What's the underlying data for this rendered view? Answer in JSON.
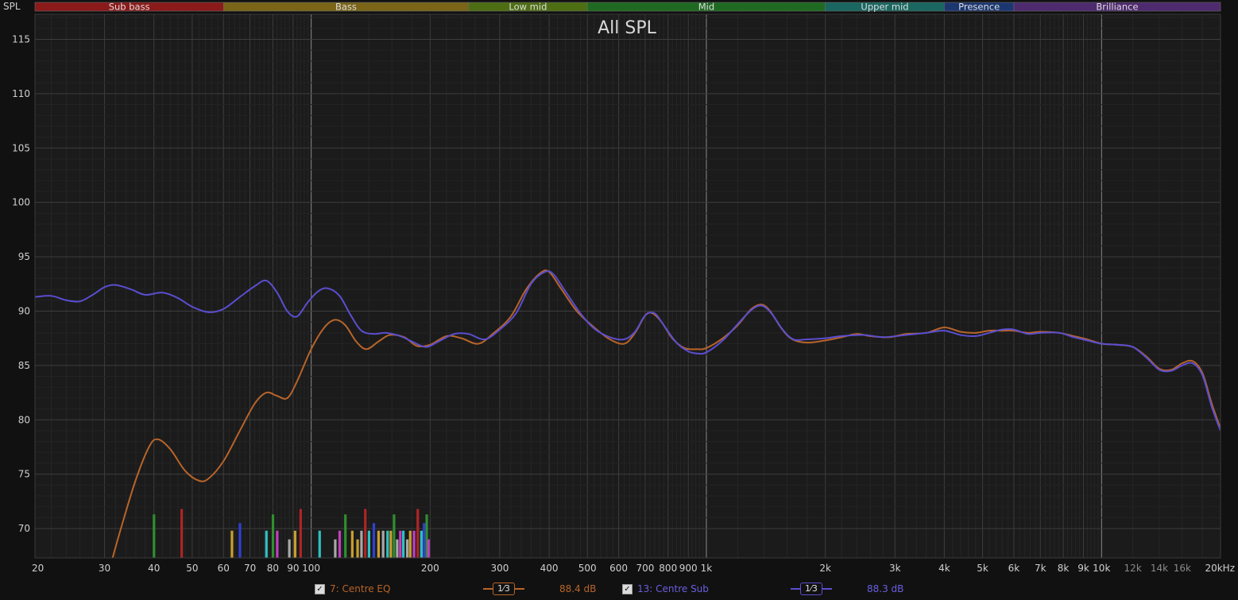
{
  "chart_data": {
    "type": "line",
    "title": "All SPL",
    "ylabel": "SPL",
    "x_scale": "log",
    "xlim": [
      20,
      20000
    ],
    "ylim": [
      67.3,
      117.3
    ],
    "y_ticks": [
      70,
      75,
      80,
      85,
      90,
      95,
      100,
      105,
      110,
      115
    ],
    "x_ticks": [
      {
        "v": 20,
        "label": "20"
      },
      {
        "v": 30,
        "label": "30"
      },
      {
        "v": 40,
        "label": "40"
      },
      {
        "v": 50,
        "label": "50"
      },
      {
        "v": 60,
        "label": "60"
      },
      {
        "v": 70,
        "label": "70"
      },
      {
        "v": 80,
        "label": "80"
      },
      {
        "v": 90,
        "label": "90"
      },
      {
        "v": 100,
        "label": "100"
      },
      {
        "v": 200,
        "label": "200"
      },
      {
        "v": 300,
        "label": "300"
      },
      {
        "v": 400,
        "label": "400"
      },
      {
        "v": 500,
        "label": "500"
      },
      {
        "v": 600,
        "label": "600"
      },
      {
        "v": 700,
        "label": "700"
      },
      {
        "v": 800,
        "label": "800"
      },
      {
        "v": 900,
        "label": "900"
      },
      {
        "v": 1000,
        "label": "1k"
      },
      {
        "v": 2000,
        "label": "2k"
      },
      {
        "v": 3000,
        "label": "3k"
      },
      {
        "v": 4000,
        "label": "4k"
      },
      {
        "v": 5000,
        "label": "5k"
      },
      {
        "v": 6000,
        "label": "6k"
      },
      {
        "v": 7000,
        "label": "7k"
      },
      {
        "v": 8000,
        "label": "8k"
      },
      {
        "v": 9000,
        "label": "9k"
      },
      {
        "v": 10000,
        "label": "10k"
      },
      {
        "v": 12000,
        "label": "12k"
      },
      {
        "v": 14000,
        "label": "14k"
      },
      {
        "v": 16000,
        "label": "16k"
      },
      {
        "v": 20000,
        "label": "20kHz"
      }
    ],
    "grid": true,
    "bands": [
      {
        "name": "Sub bass",
        "from": 20,
        "to": 60,
        "color": "#8b1a1a"
      },
      {
        "name": "Bass",
        "from": 60,
        "to": 250,
        "color": "#7a6418"
      },
      {
        "name": "Low mid",
        "from": 250,
        "to": 500,
        "color": "#4e6e14"
      },
      {
        "name": "Mid",
        "from": 500,
        "to": 2000,
        "color": "#1f6a22"
      },
      {
        "name": "Upper mid",
        "from": 2000,
        "to": 4000,
        "color": "#1a6660"
      },
      {
        "name": "Presence",
        "from": 4000,
        "to": 6000,
        "color": "#1c3770"
      },
      {
        "name": "Brilliance",
        "from": 6000,
        "to": 20000,
        "color": "#4e2a6e"
      }
    ],
    "series": [
      {
        "name": "7: Centre EQ",
        "color": "#b8642a",
        "points": [
          [
            31,
            66.5
          ],
          [
            33,
            70
          ],
          [
            36,
            74.5
          ],
          [
            39,
            77.6
          ],
          [
            41,
            78.2
          ],
          [
            44,
            77.3
          ],
          [
            48,
            75.3
          ],
          [
            52,
            74.4
          ],
          [
            55,
            74.6
          ],
          [
            60,
            76.2
          ],
          [
            66,
            79
          ],
          [
            72,
            81.5
          ],
          [
            77,
            82.5
          ],
          [
            82,
            82.2
          ],
          [
            87,
            82
          ],
          [
            92,
            83.5
          ],
          [
            100,
            86.5
          ],
          [
            108,
            88.5
          ],
          [
            115,
            89.2
          ],
          [
            122,
            88.7
          ],
          [
            130,
            87.2
          ],
          [
            138,
            86.5
          ],
          [
            148,
            87.2
          ],
          [
            158,
            87.8
          ],
          [
            172,
            87.6
          ],
          [
            185,
            86.8
          ],
          [
            200,
            86.9
          ],
          [
            220,
            87.7
          ],
          [
            240,
            87.5
          ],
          [
            265,
            87
          ],
          [
            290,
            88
          ],
          [
            320,
            89.5
          ],
          [
            350,
            92
          ],
          [
            380,
            93.5
          ],
          [
            400,
            93.6
          ],
          [
            430,
            92
          ],
          [
            470,
            90
          ],
          [
            520,
            88.5
          ],
          [
            570,
            87.4
          ],
          [
            620,
            87
          ],
          [
            660,
            88
          ],
          [
            700,
            89.6
          ],
          [
            730,
            89.8
          ],
          [
            770,
            89
          ],
          [
            820,
            87.5
          ],
          [
            880,
            86.6
          ],
          [
            950,
            86.5
          ],
          [
            1000,
            86.6
          ],
          [
            1100,
            87.5
          ],
          [
            1200,
            88.7
          ],
          [
            1300,
            90.2
          ],
          [
            1380,
            90.6
          ],
          [
            1450,
            90
          ],
          [
            1550,
            88.4
          ],
          [
            1650,
            87.4
          ],
          [
            1800,
            87.1
          ],
          [
            2000,
            87.3
          ],
          [
            2200,
            87.6
          ],
          [
            2400,
            87.9
          ],
          [
            2600,
            87.7
          ],
          [
            2900,
            87.6
          ],
          [
            3200,
            87.9
          ],
          [
            3600,
            88
          ],
          [
            4000,
            88.5
          ],
          [
            4400,
            88.1
          ],
          [
            4800,
            88
          ],
          [
            5200,
            88.2
          ],
          [
            5600,
            88.2
          ],
          [
            6000,
            88.2
          ],
          [
            6500,
            88
          ],
          [
            7000,
            88.1
          ],
          [
            7800,
            88
          ],
          [
            8500,
            87.7
          ],
          [
            9200,
            87.4
          ],
          [
            10000,
            87
          ],
          [
            11000,
            86.9
          ],
          [
            12000,
            86.7
          ],
          [
            13000,
            85.8
          ],
          [
            14000,
            84.7
          ],
          [
            15000,
            84.6
          ],
          [
            16000,
            85.2
          ],
          [
            17000,
            85.4
          ],
          [
            18000,
            84.3
          ],
          [
            19000,
            81.5
          ],
          [
            20000,
            79.2
          ]
        ]
      },
      {
        "name": "13: Centre Sub",
        "color": "#5a4ed0",
        "points": [
          [
            20,
            91.3
          ],
          [
            22,
            91.4
          ],
          [
            24,
            91
          ],
          [
            26,
            90.9
          ],
          [
            28,
            91.5
          ],
          [
            30,
            92.2
          ],
          [
            32,
            92.4
          ],
          [
            35,
            92
          ],
          [
            38,
            91.5
          ],
          [
            42,
            91.7
          ],
          [
            46,
            91.2
          ],
          [
            50,
            90.4
          ],
          [
            55,
            89.9
          ],
          [
            60,
            90.2
          ],
          [
            66,
            91.3
          ],
          [
            72,
            92.3
          ],
          [
            77,
            92.8
          ],
          [
            82,
            91.7
          ],
          [
            87,
            90
          ],
          [
            92,
            89.5
          ],
          [
            98,
            90.8
          ],
          [
            104,
            91.8
          ],
          [
            110,
            92.1
          ],
          [
            118,
            91.4
          ],
          [
            126,
            89.6
          ],
          [
            134,
            88.2
          ],
          [
            144,
            87.9
          ],
          [
            155,
            88
          ],
          [
            168,
            87.7
          ],
          [
            180,
            87.2
          ],
          [
            195,
            86.7
          ],
          [
            210,
            87.2
          ],
          [
            230,
            87.9
          ],
          [
            250,
            87.9
          ],
          [
            275,
            87.4
          ],
          [
            300,
            88.3
          ],
          [
            330,
            89.8
          ],
          [
            360,
            92.5
          ],
          [
            390,
            93.6
          ],
          [
            410,
            93.4
          ],
          [
            440,
            91.8
          ],
          [
            480,
            89.8
          ],
          [
            520,
            88.4
          ],
          [
            570,
            87.6
          ],
          [
            620,
            87.4
          ],
          [
            660,
            88.1
          ],
          [
            700,
            89.6
          ],
          [
            740,
            89.8
          ],
          [
            780,
            88.7
          ],
          [
            840,
            87.1
          ],
          [
            900,
            86.3
          ],
          [
            950,
            86.1
          ],
          [
            1000,
            86.2
          ],
          [
            1100,
            87.3
          ],
          [
            1200,
            88.8
          ],
          [
            1300,
            90.1
          ],
          [
            1380,
            90.5
          ],
          [
            1460,
            89.8
          ],
          [
            1560,
            88.3
          ],
          [
            1660,
            87.4
          ],
          [
            1800,
            87.4
          ],
          [
            2000,
            87.5
          ],
          [
            2200,
            87.7
          ],
          [
            2500,
            87.8
          ],
          [
            2800,
            87.6
          ],
          [
            3200,
            87.8
          ],
          [
            3600,
            88
          ],
          [
            4000,
            88.2
          ],
          [
            4400,
            87.8
          ],
          [
            4800,
            87.7
          ],
          [
            5200,
            88
          ],
          [
            5600,
            88.3
          ],
          [
            6000,
            88.3
          ],
          [
            6500,
            87.9
          ],
          [
            7000,
            88
          ],
          [
            7800,
            88
          ],
          [
            8500,
            87.6
          ],
          [
            9200,
            87.3
          ],
          [
            10000,
            87
          ],
          [
            11000,
            86.9
          ],
          [
            12000,
            86.7
          ],
          [
            13000,
            85.7
          ],
          [
            14000,
            84.6
          ],
          [
            15000,
            84.5
          ],
          [
            16000,
            85
          ],
          [
            17000,
            85.2
          ],
          [
            18000,
            84.1
          ],
          [
            19000,
            81.2
          ],
          [
            20000,
            79
          ]
        ]
      }
    ],
    "filter_markers": [
      {
        "f": 40,
        "top": 71.3,
        "color": "#2f8f2f"
      },
      {
        "f": 47,
        "top": 71.8,
        "color": "#b02525"
      },
      {
        "f": 63,
        "top": 69.8,
        "color": "#c8a030"
      },
      {
        "f": 66,
        "top": 70.5,
        "color": "#3040d0"
      },
      {
        "f": 77,
        "top": 69.8,
        "color": "#30c0c0"
      },
      {
        "f": 80,
        "top": 71.3,
        "color": "#2f8f2f"
      },
      {
        "f": 82,
        "top": 69.8,
        "color": "#c040c0"
      },
      {
        "f": 88,
        "top": 69,
        "color": "#a8a8a8"
      },
      {
        "f": 91,
        "top": 69.8,
        "color": "#c8a030"
      },
      {
        "f": 94,
        "top": 71.8,
        "color": "#b02525"
      },
      {
        "f": 105,
        "top": 69.8,
        "color": "#30c0c0"
      },
      {
        "f": 115,
        "top": 69,
        "color": "#a8a8a8"
      },
      {
        "f": 118,
        "top": 69.8,
        "color": "#c040c0"
      },
      {
        "f": 122,
        "top": 71.3,
        "color": "#2f8f2f"
      },
      {
        "f": 127,
        "top": 69.8,
        "color": "#c8a030"
      },
      {
        "f": 131,
        "top": 69,
        "color": "#c8a030"
      },
      {
        "f": 134,
        "top": 69.8,
        "color": "#a8a8a8"
      },
      {
        "f": 137,
        "top": 71.8,
        "color": "#b02525"
      },
      {
        "f": 140,
        "top": 69.8,
        "color": "#30c0c0"
      },
      {
        "f": 144,
        "top": 70.5,
        "color": "#3040d0"
      },
      {
        "f": 148,
        "top": 69.8,
        "color": "#c8a030"
      },
      {
        "f": 152,
        "top": 69.8,
        "color": "#a8a8a8"
      },
      {
        "f": 156,
        "top": 69.8,
        "color": "#30c0c0"
      },
      {
        "f": 159,
        "top": 69.8,
        "color": "#c8a030"
      },
      {
        "f": 162,
        "top": 71.3,
        "color": "#2f8f2f"
      },
      {
        "f": 165,
        "top": 69,
        "color": "#a8a8a8"
      },
      {
        "f": 168,
        "top": 69.8,
        "color": "#c040c0"
      },
      {
        "f": 171,
        "top": 69.8,
        "color": "#30c0c0"
      },
      {
        "f": 175,
        "top": 69,
        "color": "#a8a8a8"
      },
      {
        "f": 178,
        "top": 69.8,
        "color": "#c8a030"
      },
      {
        "f": 182,
        "top": 69.8,
        "color": "#c040c0"
      },
      {
        "f": 186,
        "top": 71.8,
        "color": "#b02525"
      },
      {
        "f": 190,
        "top": 69.8,
        "color": "#30c0c0"
      },
      {
        "f": 193,
        "top": 70.5,
        "color": "#3040d0"
      },
      {
        "f": 196,
        "top": 71.3,
        "color": "#2f8f2f"
      },
      {
        "f": 198,
        "top": 69,
        "color": "#c040c0"
      }
    ]
  },
  "legend": [
    {
      "checkbox": "✓",
      "label": "7: Centre EQ",
      "smoothing": "1⁄3",
      "value": "88.4 dB",
      "color": "#b8642a"
    },
    {
      "checkbox": "✓",
      "label": "13: Centre Sub",
      "smoothing": "1⁄3",
      "value": "88.3 dB",
      "color": "#5a4ed0"
    }
  ]
}
